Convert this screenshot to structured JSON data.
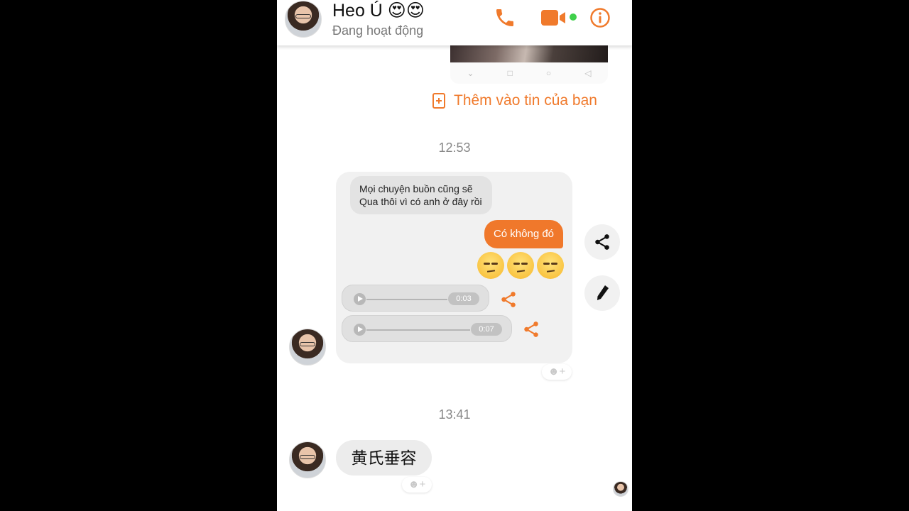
{
  "header": {
    "contact_name": "Heo Ú 😍😍",
    "status": "Đang hoạt động",
    "icons": [
      "phone-icon",
      "video-icon",
      "info-icon"
    ],
    "accent_color": "#f07a2c"
  },
  "story": {
    "add_label": "Thêm vào tin của bạn"
  },
  "messages": {
    "time1": "12:53",
    "shared_text_line1": "Mọi chuyện buồn cũng sẽ",
    "shared_text_line2": "Qua thôi vì có anh ở đây rồi",
    "shared_reply": "Có không đó",
    "voice1_duration": "0:03",
    "voice2_duration": "0:07",
    "time2": "13:41",
    "last_message": "黄氏垂容",
    "react_label": "☻+"
  }
}
